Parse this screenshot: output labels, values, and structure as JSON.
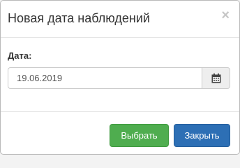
{
  "dialog": {
    "title": "Новая дата наблюдений",
    "close_glyph": "×"
  },
  "form": {
    "date_label": "Дата:",
    "date_value": "19.06.2019",
    "calendar_icon": "calendar-icon"
  },
  "footer": {
    "select_label": "Выбрать",
    "close_label": "Закрыть"
  },
  "colors": {
    "select_button": "#4fad4f",
    "close_button": "#2d6fb5"
  }
}
